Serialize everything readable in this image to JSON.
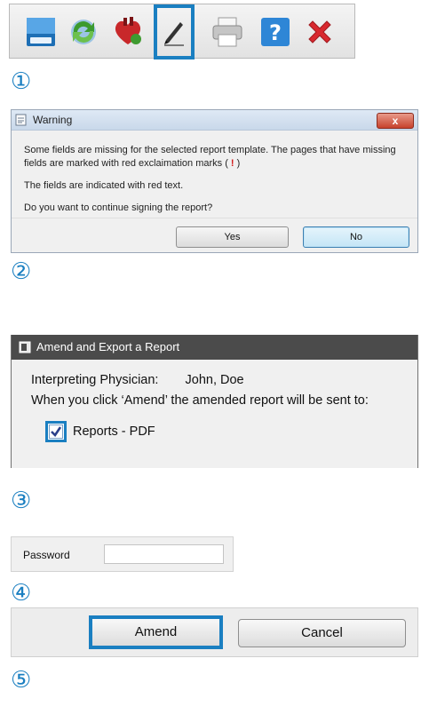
{
  "toolbar": {
    "buttons": [
      {
        "icon": "save-icon"
      },
      {
        "icon": "refresh-icon"
      },
      {
        "icon": "heart-icon"
      },
      {
        "icon": "pen-sign-icon",
        "selected": true
      },
      {
        "icon": "print-icon"
      },
      {
        "icon": "help-icon"
      },
      {
        "icon": "close-icon"
      }
    ]
  },
  "steps": [
    "①",
    "②",
    "③",
    "④",
    "⑤"
  ],
  "warning_dialog": {
    "title": "Warning",
    "close_label": "x",
    "message_1": "Some fields are missing for the selected report template. The pages that have missing fields are marked with red exclaimation marks (",
    "exclaim": "!",
    "message_1_end": ")",
    "message_2": "The fields are indicated with red text.",
    "message_3": "Do you want to continue signing the report?",
    "yes_label": "Yes",
    "no_label": "No"
  },
  "amend_dialog": {
    "title": "Amend and Export a Report",
    "physician_label": "Interpreting Physician:",
    "physician_value": "John, Doe",
    "info_text": "When you click ‘Amend’ the amended report will be sent to:",
    "checkbox_label": "Reports - PDF",
    "checkbox_checked": true
  },
  "password": {
    "label": "Password",
    "value": ""
  },
  "action_bar": {
    "amend_label": "Amend",
    "cancel_label": "Cancel"
  },
  "colors": {
    "highlight": "#1a7fc1"
  }
}
